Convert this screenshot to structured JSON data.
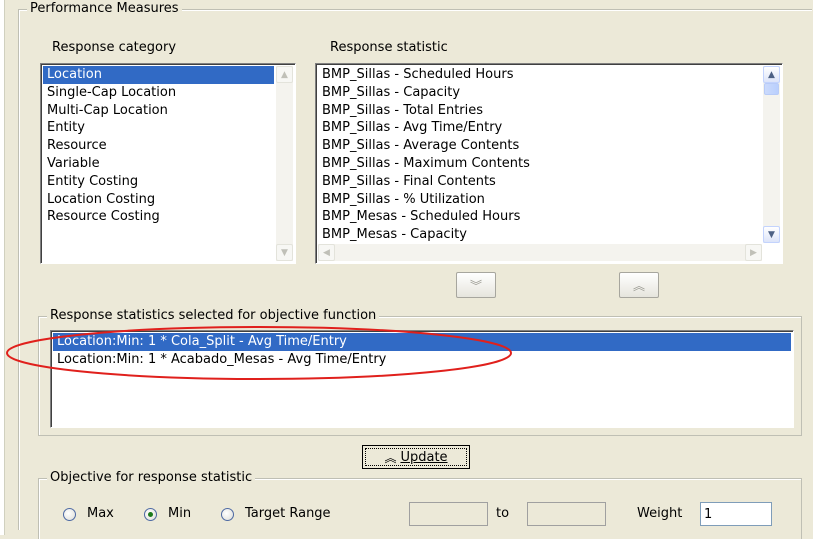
{
  "performance_group": {
    "title": "Performance Measures"
  },
  "response_category": {
    "label": "Response category",
    "items": [
      "Location",
      "Single-Cap Location",
      "Multi-Cap Location",
      "Entity",
      "Resource",
      "Variable",
      "Entity Costing",
      "Location Costing",
      "Resource Costing"
    ],
    "selected": "Location"
  },
  "response_statistic": {
    "label": "Response statistic",
    "items": [
      "BMP_Sillas - Scheduled Hours",
      "BMP_Sillas - Capacity",
      "BMP_Sillas - Total Entries",
      "BMP_Sillas - Avg Time/Entry",
      "BMP_Sillas - Average Contents",
      "BMP_Sillas - Maximum Contents",
      "BMP_Sillas - Final Contents",
      "BMP_Sillas - % Utilization",
      "BMP_Mesas - Scheduled Hours",
      "BMP_Mesas - Capacity"
    ]
  },
  "move_buttons": {
    "down_icon": "double-chevron-down-icon",
    "up_icon": "double-chevron-up-icon"
  },
  "selected_group": {
    "title": "Response statistics selected for objective function",
    "items": [
      "Location:Min: 1 * Cola_Split - Avg Time/Entry",
      "Location:Min: 1 * Acabado_Mesas - Avg Time/Entry"
    ],
    "highlight_color": "#e0201c"
  },
  "update_button": {
    "label": "Update",
    "icon": "double-chevron-up-icon"
  },
  "objective_group": {
    "title": "Objective for response statistic",
    "options": [
      "Max",
      "Min",
      "Target Range"
    ],
    "selected": "Min",
    "range_from": "",
    "to_label": "to",
    "range_to": "",
    "weight_label": "Weight",
    "weight_value": "1"
  },
  "colors": {
    "selection": "#316ac5",
    "background": "#ece9d8"
  }
}
